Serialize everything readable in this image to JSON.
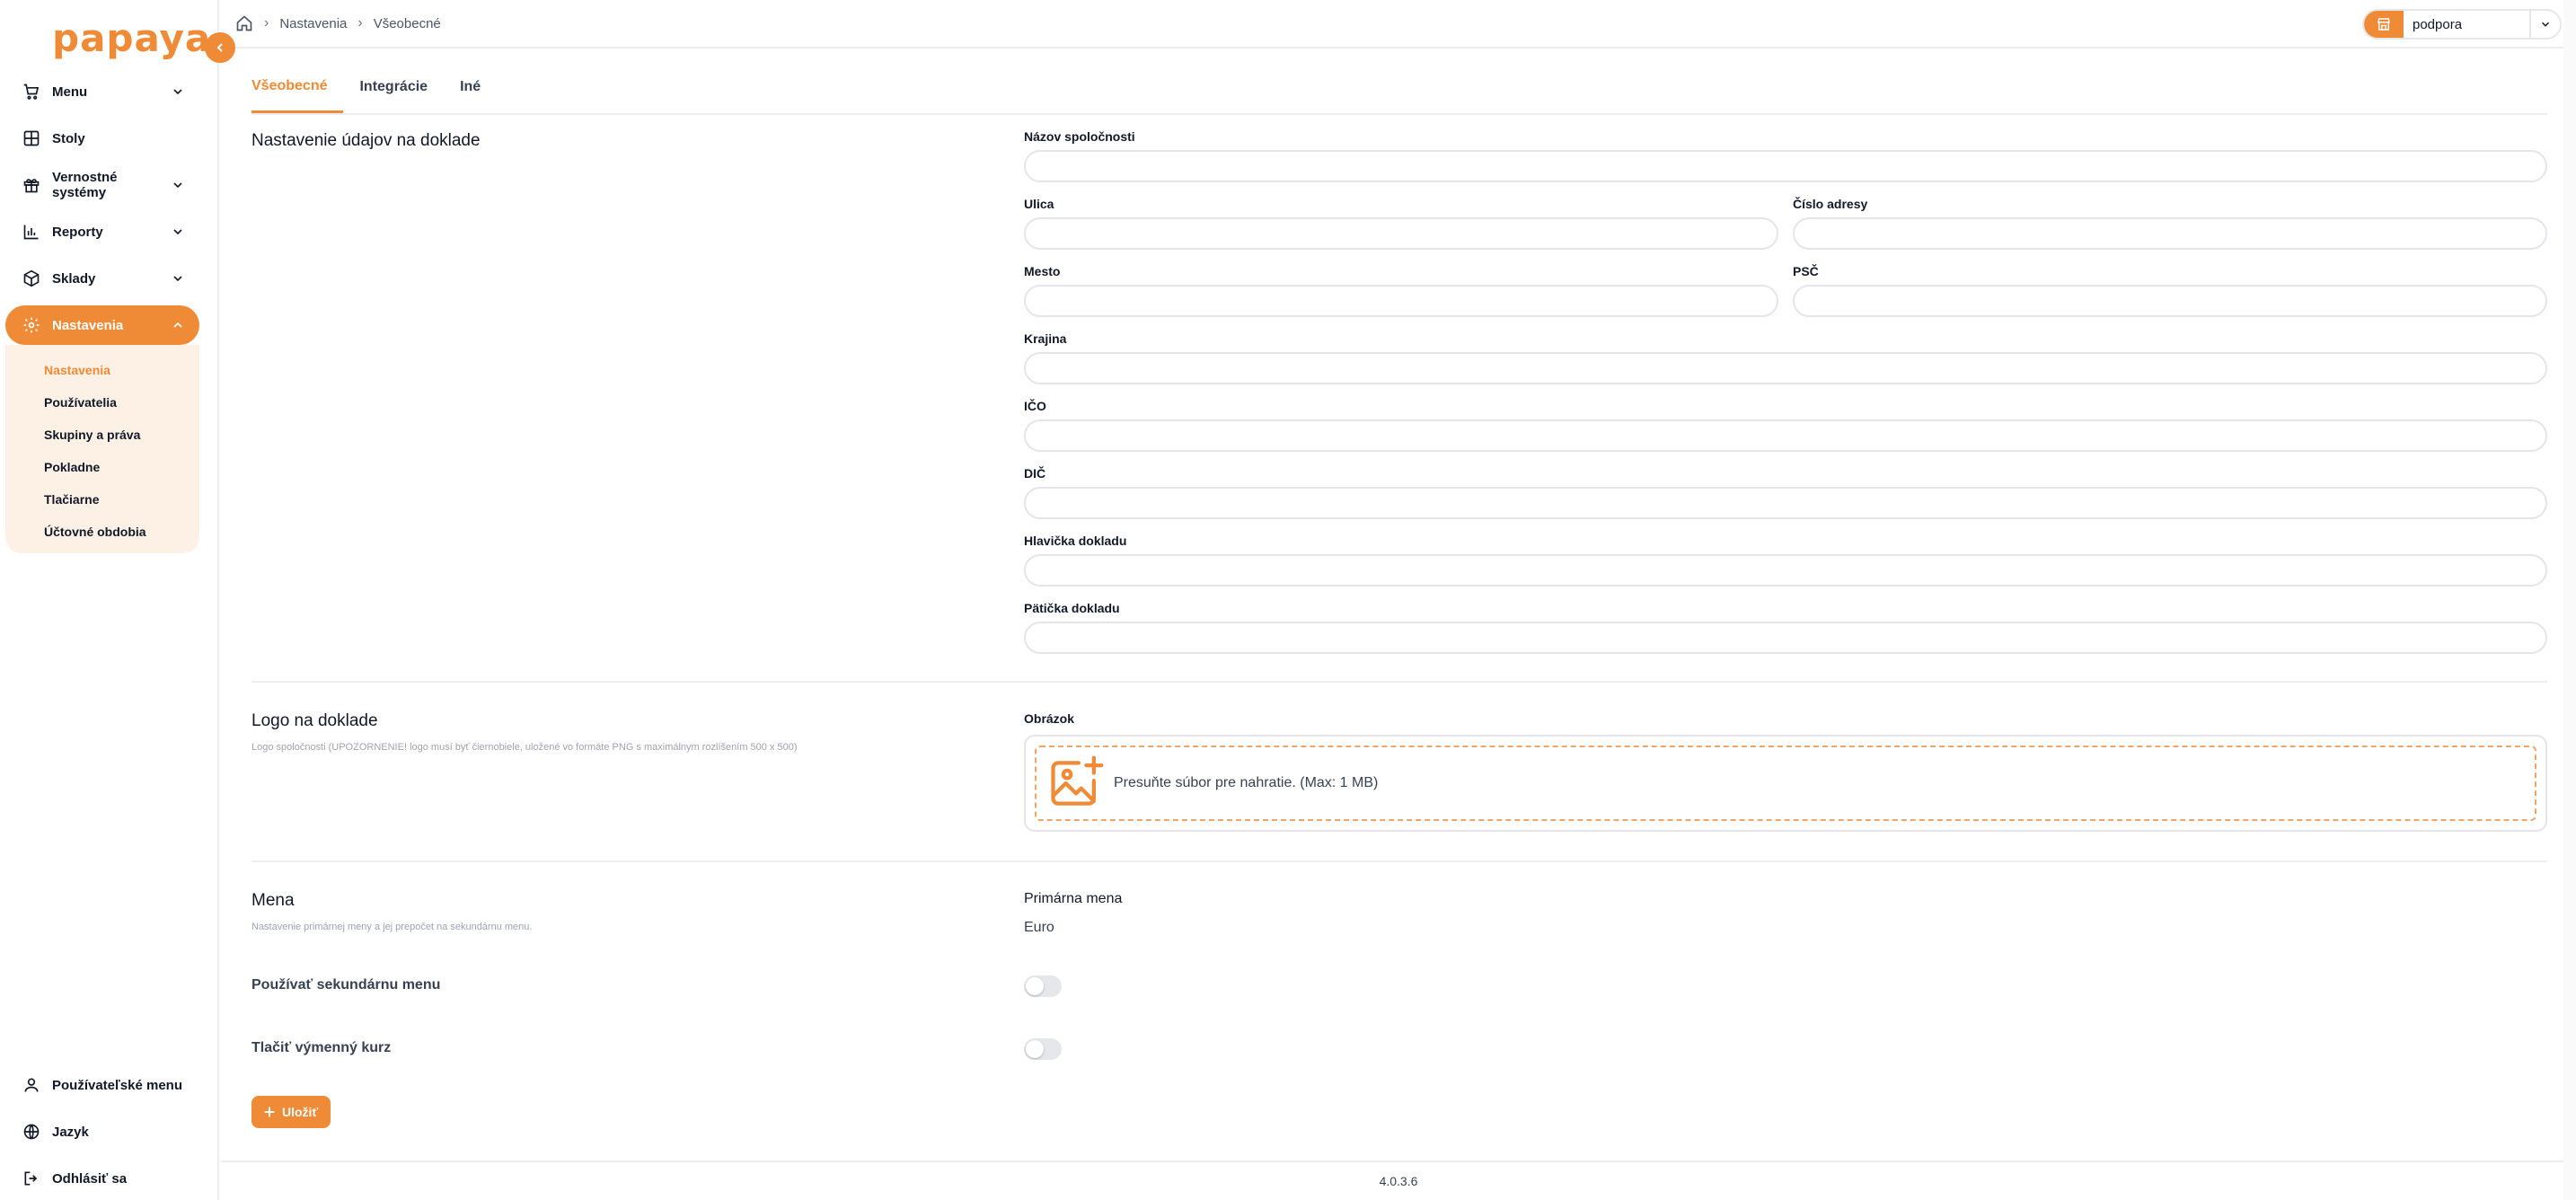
{
  "brand": {
    "logo_text": "papaya",
    "accent": "#ef8a36"
  },
  "sidebar": {
    "items": [
      {
        "label": "Menu",
        "icon": "cart-icon",
        "expandable": true
      },
      {
        "label": "Stoly",
        "icon": "table-grid-icon",
        "expandable": false
      },
      {
        "label": "Vernostné systémy",
        "icon": "gift-icon",
        "expandable": true
      },
      {
        "label": "Reporty",
        "icon": "bar-chart-icon",
        "expandable": true
      },
      {
        "label": "Sklady",
        "icon": "box-icon",
        "expandable": true
      },
      {
        "label": "Nastavenia",
        "icon": "gear-icon",
        "expandable": true,
        "active": true
      }
    ],
    "submenu": [
      "Nastavenia",
      "Používatelia",
      "Skupiny a práva",
      "Pokladne",
      "Tlačiarne",
      "Účtovné obdobia"
    ],
    "bottom": [
      {
        "label": "Používateľské menu",
        "icon": "user-icon"
      },
      {
        "label": "Jazyk",
        "icon": "globe-icon"
      },
      {
        "label": "Odhlásiť sa",
        "icon": "logout-icon"
      }
    ]
  },
  "topbar": {
    "breadcrumb": [
      "Nastavenia",
      "Všeobecné"
    ],
    "store": "podpora"
  },
  "tabs": [
    "Všeobecné",
    "Integrácie",
    "Iné"
  ],
  "receipt_section": {
    "title": "Nastavenie údajov na doklade",
    "fields": {
      "company_name": {
        "label": "Názov spoločnosti",
        "value": ""
      },
      "street": {
        "label": "Ulica",
        "value": ""
      },
      "address_number": {
        "label": "Číslo adresy",
        "value": ""
      },
      "city": {
        "label": "Mesto",
        "value": ""
      },
      "zip": {
        "label": "PSČ",
        "value": ""
      },
      "country": {
        "label": "Krajina",
        "value": ""
      },
      "ico": {
        "label": "IČO",
        "value": ""
      },
      "dic": {
        "label": "DIČ",
        "value": ""
      },
      "header": {
        "label": "Hlavička dokladu",
        "value": ""
      },
      "footer": {
        "label": "Pätička dokladu",
        "value": ""
      }
    }
  },
  "logo_section": {
    "title": "Logo na doklade",
    "description": "Logo spoločnosti (UPOZORNENIE! logo musí byť čiernobiele, uložené vo formáte PNG s maximálnym rozlíšením 500 x 500)",
    "image_label": "Obrázok",
    "upload_text": "Presuňte súbor pre nahratie. (Max: 1 MB)"
  },
  "currency_section": {
    "title": "Mena",
    "description": "Nastavenie primárnej meny a jej prepočet na sekundárnu menu.",
    "primary_label": "Primárna mena",
    "primary_value": "Euro",
    "secondary_label": "Používať sekundárnu menu",
    "secondary_enabled": false,
    "print_rate_label": "Tlačiť výmenný kurz",
    "print_rate_enabled": false
  },
  "actions": {
    "save_label": "Uložiť"
  },
  "footer": {
    "version": "4.0.3.6"
  }
}
